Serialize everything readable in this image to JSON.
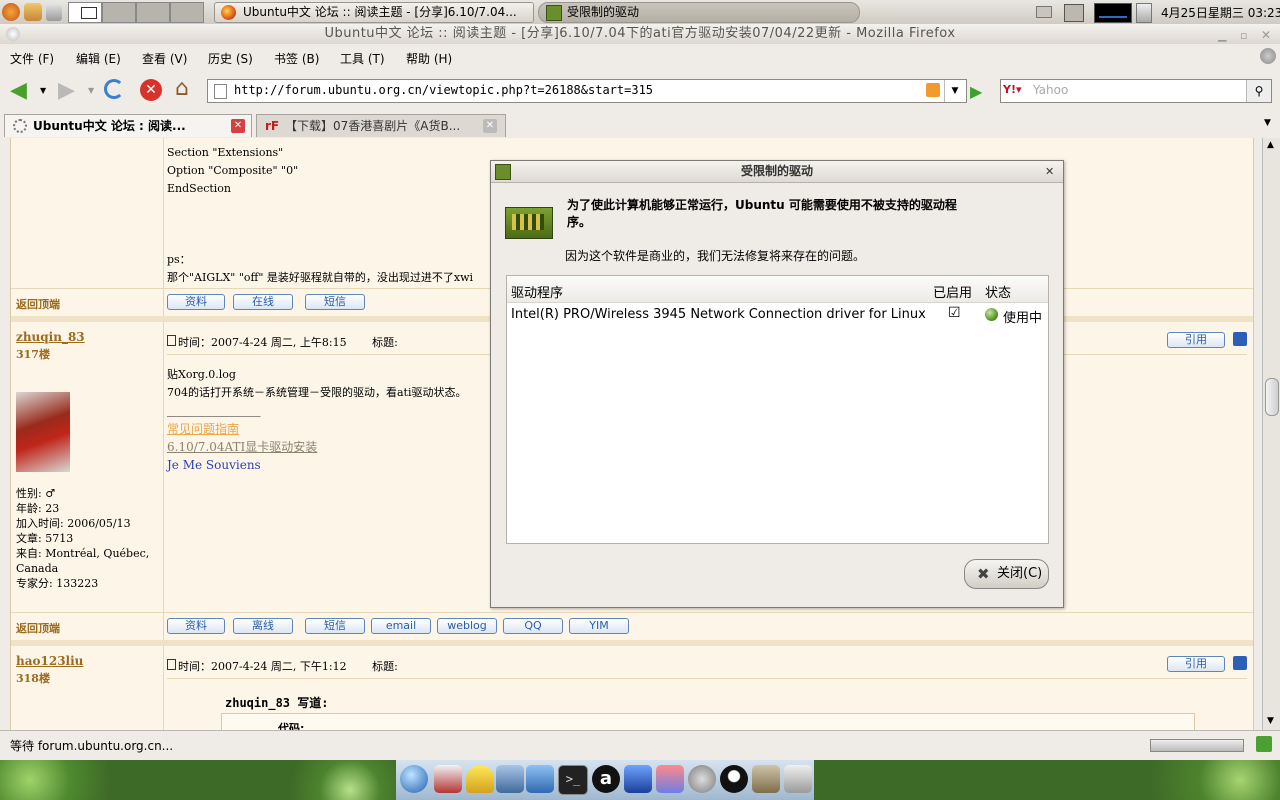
{
  "top_panel": {
    "task_firefox": "Ubuntu中文 论坛 :: 阅读主题 - [分享]6.10/7.04...",
    "task_dialog": "受限制的驱动",
    "clock": "4月25日星期三 03:23"
  },
  "firefox": {
    "window_title": "Ubuntu中文 论坛 :: 阅读主题 - [分享]6.10/7.04下的ati官方驱动安装07/04/22更新 - Mozilla Firefox",
    "menu": [
      "文件 (F)",
      "编辑 (E)",
      "查看 (V)",
      "历史 (S)",
      "书签 (B)",
      "工具 (T)",
      "帮助 (H)"
    ],
    "url": "http://forum.ubuntu.org.cn/viewtopic.php?t=26188&start=315",
    "search_placeholder": "Yahoo",
    "tabs": [
      {
        "label": "Ubuntu中文 论坛 : 阅读..."
      },
      {
        "label": "【下载】07香港喜剧片《A货B..."
      }
    ],
    "status_text": "等待 forum.ubuntu.org.cn..."
  },
  "forum": {
    "code_lines": [
      "Section \"Extensions\"",
      "Option \"Composite\" \"0\"",
      "EndSection"
    ],
    "ps_label": "ps：",
    "ps_text": "那个\"AIGLX\" \"off\" 是装好驱程就自带的，没出现过进不了xwi",
    "back_top_1": "返回顶端",
    "back_top_2": "返回顶端",
    "buttons_row1": [
      "资料",
      "在线",
      "短信"
    ],
    "buttons_row2": [
      "资料",
      "离线",
      "短信",
      "email",
      "weblog",
      "QQ",
      "YIM"
    ],
    "post1": {
      "author": "zhuqin_83",
      "floor": "317楼",
      "time": "时间：2007-4-24 周二, 上午8:15",
      "subject_label": "标题:",
      "quote_btn": "引用",
      "line1": "贴Xorg.0.log",
      "line2": "704的话打开系统－系统管理－受限的驱动，看ati驱动状态。",
      "separator": "_________________",
      "sig_link1": "常见问题指南",
      "sig_link2": "6.10/7.04ATI显卡驱动安装",
      "sig_text": "Je Me Souviens",
      "profile": [
        "性别: ♂",
        "年龄: 23",
        "加入时间: 2006/05/13",
        "文章: 5713",
        "来自: Montréal, Québec,",
        "Canada",
        "专家分: 133223"
      ]
    },
    "post2": {
      "author": "hao123liu",
      "floor": "318楼",
      "time": "时间：2007-4-24 周二, 下午1:12",
      "subject_label": "标题:",
      "quote_btn": "引用",
      "quote_author": "zhuqin_83 写道:",
      "code_label": "代码:"
    }
  },
  "dialog": {
    "title": "受限制的驱动",
    "heading": "为了使此计算机能够正常运行，Ubuntu 可能需要使用不被支持的驱动程序。",
    "subtext": "因为这个软件是商业的，我们无法修复将来存在的问题。",
    "columns": [
      "驱动程序",
      "已启用",
      "状态"
    ],
    "rows": [
      {
        "driver": "Intel(R) PRO/Wireless 3945 Network Connection driver for Linux",
        "enabled": "☑",
        "status": "使用中"
      }
    ],
    "close_label": "关闭(C)"
  }
}
